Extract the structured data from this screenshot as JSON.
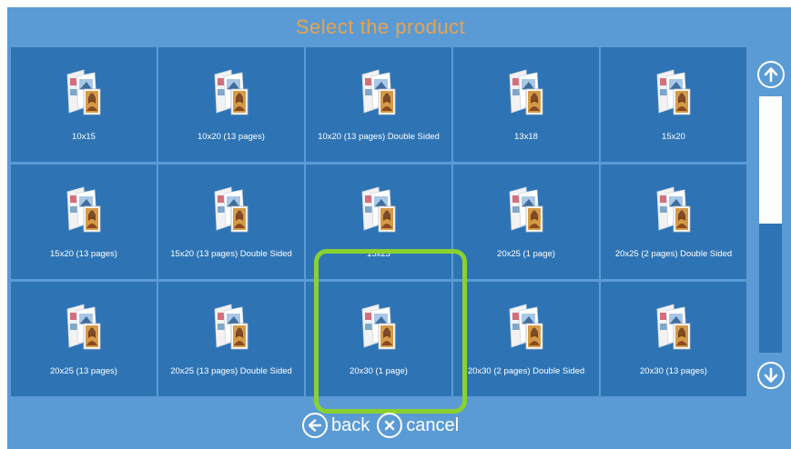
{
  "title": "Select the product",
  "products": [
    {
      "label": "10x15"
    },
    {
      "label": "10x20 (13 pages)"
    },
    {
      "label": "10x20 (13 pages) Double Sided"
    },
    {
      "label": "13x18"
    },
    {
      "label": "15x20"
    },
    {
      "label": "15x20 (13 pages)"
    },
    {
      "label": "15x20 (13 pages) Double Sided"
    },
    {
      "label": "15x23"
    },
    {
      "label": "20x25 (1 page)"
    },
    {
      "label": "20x25 (2 pages) Double Sided"
    },
    {
      "label": "20x25 (13 pages)"
    },
    {
      "label": "20x25 (13 pages) Double Sided"
    },
    {
      "label": "20x30 (1 page)"
    },
    {
      "label": "20x30 (2 pages) Double Sided"
    },
    {
      "label": "20x30 (13 pages)"
    }
  ],
  "selected_index": 12,
  "nav": {
    "back_label": "back",
    "cancel_label": "cancel"
  },
  "colors": {
    "background": "#5b9bd5",
    "tile": "#2e74b5",
    "title": "#e7a34e",
    "highlight": "#8ad12f"
  },
  "icons": {
    "scroll_up": "arrow-up-circle-icon",
    "scroll_down": "arrow-down-circle-icon",
    "back": "arrow-left-circle-icon",
    "cancel": "x-circle-icon",
    "product": "photo-product-icon"
  },
  "scroll_position": 0.45
}
